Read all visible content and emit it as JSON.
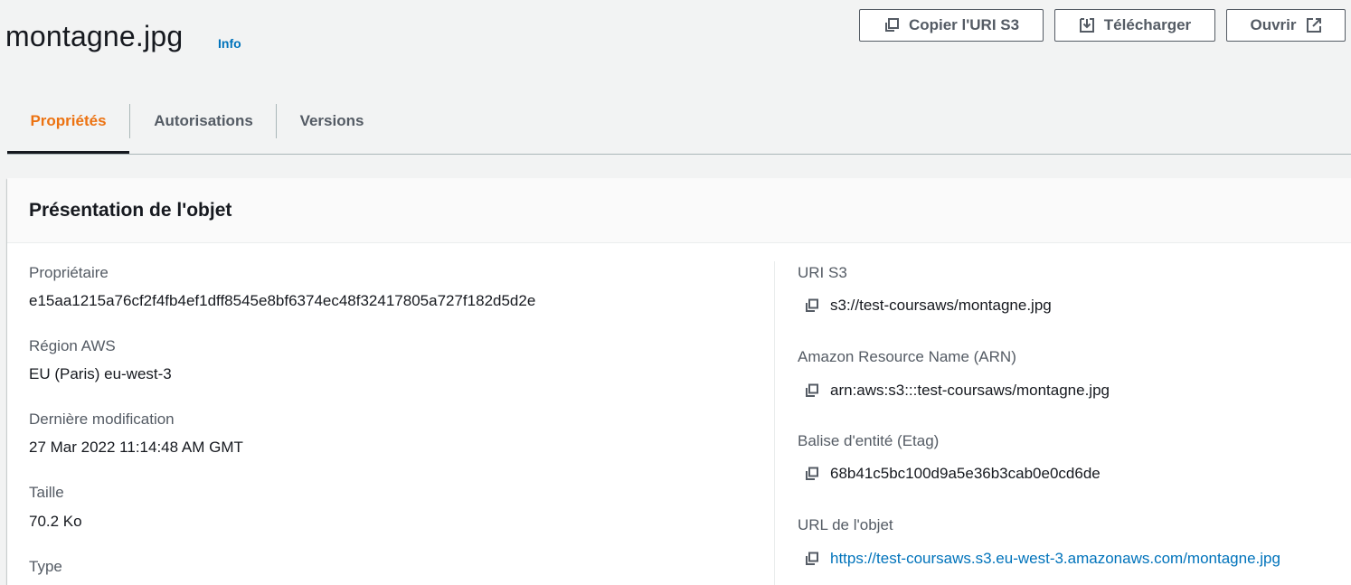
{
  "header": {
    "title": "montagne.jpg",
    "info": "Info",
    "buttons": {
      "copy_uri": "Copier l'URI S3",
      "download": "Télécharger",
      "open": "Ouvrir"
    }
  },
  "tabs": [
    {
      "label": "Propriétés",
      "active": true
    },
    {
      "label": "Autorisations",
      "active": false
    },
    {
      "label": "Versions",
      "active": false
    }
  ],
  "overview": {
    "title": "Présentation de l'objet",
    "left": {
      "owner_label": "Propriétaire",
      "owner_value": "e15aa1215a76cf2f4fb4ef1dff8545e8bf6374ec48f32417805a727f182d5d2e",
      "region_label": "Région AWS",
      "region_value": "EU (Paris) eu-west-3",
      "modified_label": "Dernière modification",
      "modified_value": "27 Mar 2022 11:14:48 AM GMT",
      "size_label": "Taille",
      "size_value": "70.2 Ko",
      "type_label": "Type"
    },
    "right": {
      "uri_label": "URI S3",
      "uri_value": "s3://test-coursaws/montagne.jpg",
      "arn_label": "Amazon Resource Name (ARN)",
      "arn_value": "arn:aws:s3:::test-coursaws/montagne.jpg",
      "etag_label": "Balise d'entité (Etag)",
      "etag_value": "68b41c5bc100d9a5e36b3cab0e0cd6de",
      "url_label": "URL de l'objet",
      "url_value": "https://test-coursaws.s3.eu-west-3.amazonaws.com/montagne.jpg"
    }
  },
  "colors": {
    "active_tab": "#ec7211",
    "link": "#0073bb",
    "text": "#16191f",
    "muted": "#545b64"
  },
  "icons": {
    "copy": "copy-icon",
    "download": "download-icon",
    "external": "external-link-icon"
  }
}
